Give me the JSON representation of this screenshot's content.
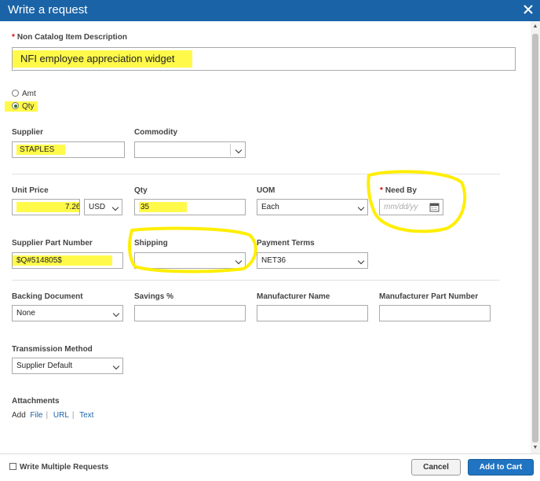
{
  "dialog": {
    "title": "Write a request"
  },
  "description": {
    "label": "Non Catalog Item Description",
    "value": "NFI employee appreciation widget"
  },
  "mode": {
    "amt_label": "Amt",
    "qty_label": "Qty",
    "selected": "Qty"
  },
  "supplier": {
    "label": "Supplier",
    "value": "STAPLES"
  },
  "commodity": {
    "label": "Commodity",
    "value": ""
  },
  "unit_price": {
    "label": "Unit Price",
    "value": "7.26",
    "currency": "USD"
  },
  "qty": {
    "label": "Qty",
    "value": "35"
  },
  "uom": {
    "label": "UOM",
    "value": "Each"
  },
  "need_by": {
    "label": "Need By",
    "placeholder": "mm/dd/yy"
  },
  "supplier_part": {
    "label": "Supplier Part Number",
    "value": "$Q#514805$"
  },
  "shipping": {
    "label": "Shipping",
    "value": ""
  },
  "payment_terms": {
    "label": "Payment Terms",
    "value": "NET36"
  },
  "backing_document": {
    "label": "Backing Document",
    "value": "None"
  },
  "savings": {
    "label": "Savings %",
    "value": ""
  },
  "manufacturer_name": {
    "label": "Manufacturer Name",
    "value": ""
  },
  "manufacturer_part": {
    "label": "Manufacturer Part Number",
    "value": ""
  },
  "transmission": {
    "label": "Transmission Method",
    "value": "Supplier Default"
  },
  "attachments": {
    "label": "Attachments",
    "add": "Add",
    "file": "File",
    "url": "URL",
    "text": "Text"
  },
  "footer": {
    "write_multiple": "Write Multiple Requests",
    "cancel": "Cancel",
    "add_to_cart": "Add to Cart"
  },
  "colors": {
    "header": "#1a63a7",
    "highlight": "#fff94a",
    "primary_button": "#2174c1"
  }
}
